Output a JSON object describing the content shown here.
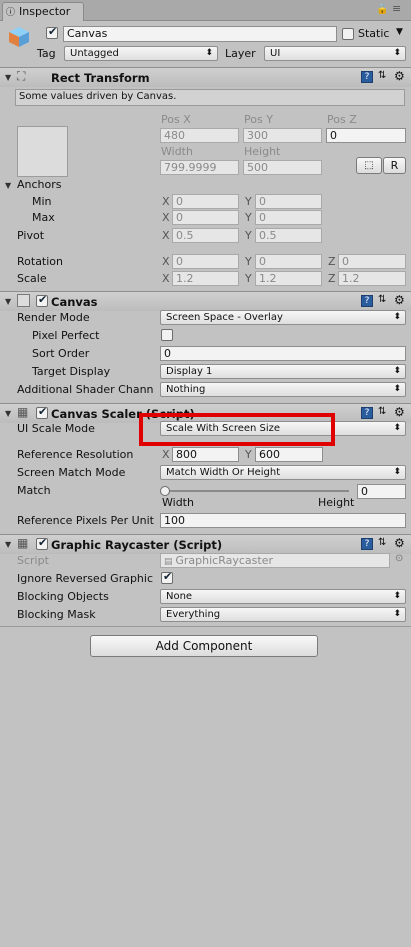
{
  "window": {
    "tab_label": "Inspector"
  },
  "object": {
    "name": "Canvas",
    "static_label": "Static",
    "tag_label": "Tag",
    "tag_value": "Untagged",
    "layer_label": "Layer",
    "layer_value": "UI"
  },
  "rect_transform": {
    "title": "Rect Transform",
    "info": "Some values driven by Canvas.",
    "pos_x_label": "Pos X",
    "pos_y_label": "Pos Y",
    "pos_z_label": "Pos Z",
    "pos_x": "480",
    "pos_y": "300",
    "pos_z": "0",
    "width_label": "Width",
    "height_label": "Height",
    "width": "799.9999",
    "height": "500",
    "r_button": "R",
    "anchors_label": "Anchors",
    "min_label": "Min",
    "min_x": "0",
    "min_y": "0",
    "max_label": "Max",
    "max_x": "0",
    "max_y": "0",
    "pivot_label": "Pivot",
    "pivot_x": "0.5",
    "pivot_y": "0.5",
    "rotation_label": "Rotation",
    "rot_x": "0",
    "rot_y": "0",
    "rot_z": "0",
    "scale_label": "Scale",
    "scale_x": "1.2",
    "scale_y": "1.2",
    "scale_z": "1.2",
    "axis_x": "X",
    "axis_y": "Y",
    "axis_z": "Z"
  },
  "canvas": {
    "title": "Canvas",
    "render_mode_label": "Render Mode",
    "render_mode": "Screen Space - Overlay",
    "pixel_perfect_label": "Pixel Perfect",
    "sort_order_label": "Sort Order",
    "sort_order": "0",
    "target_display_label": "Target Display",
    "target_display": "Display 1",
    "shader_label": "Additional Shader Chann",
    "shader_value": "Nothing"
  },
  "scaler": {
    "title": "Canvas Scaler (Script)",
    "ui_scale_label": "UI Scale Mode",
    "ui_scale": "Scale With Screen Size",
    "ref_res_label": "Reference Resolution",
    "ref_x": "800",
    "ref_y": "600",
    "match_mode_label": "Screen Match Mode",
    "match_mode": "Match Width Or Height",
    "match_label": "Match",
    "match_value": "0",
    "match_fraction": 0,
    "width_label": "Width",
    "height_label": "Height",
    "ppu_label": "Reference Pixels Per Unit",
    "ppu": "100"
  },
  "raycaster": {
    "title": "Graphic Raycaster (Script)",
    "script_label": "Script",
    "script_value": "GraphicRaycaster",
    "ignore_label": "Ignore Reversed Graphic",
    "blocking_objects_label": "Blocking Objects",
    "blocking_objects": "None",
    "blocking_mask_label": "Blocking Mask",
    "blocking_mask": "Everything"
  },
  "add_component": "Add Component",
  "colors": {
    "highlight": "#e00000",
    "panel": "#c2c2c2"
  }
}
